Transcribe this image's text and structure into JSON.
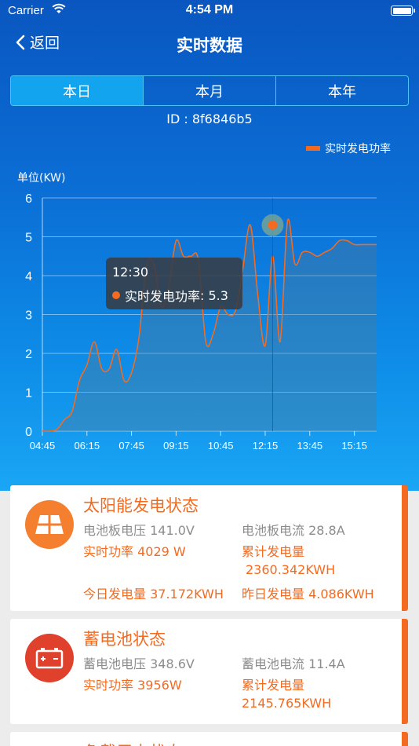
{
  "status_bar": {
    "carrier": "Carrier",
    "time": "4:54 PM"
  },
  "nav": {
    "back_label": "返回",
    "title": "实时数据"
  },
  "tabs": [
    {
      "label": "本日",
      "active": true
    },
    {
      "label": "本月",
      "active": false
    },
    {
      "label": "本年",
      "active": false
    }
  ],
  "device_id": "ID : 8f6846b5",
  "colors": {
    "accent": "#f36b21",
    "header_bg": "#0b6fd6",
    "tab_active": "#12a4ee"
  },
  "chart_data": {
    "type": "area",
    "legend": "实时发电功率",
    "legend_position": "top-right",
    "unit_label": "单位(KW)",
    "ylim": [
      0,
      6
    ],
    "yticks": [
      0,
      1,
      2,
      3,
      4,
      5,
      6
    ],
    "xlim": [
      "04:45",
      "16:00"
    ],
    "xticks": [
      "04:45",
      "06:15",
      "07:45",
      "09:15",
      "10:45",
      "12:15",
      "13:45",
      "15:15"
    ],
    "grid": true,
    "x": [
      "04:45",
      "05:00",
      "05:15",
      "05:30",
      "05:45",
      "06:00",
      "06:15",
      "06:30",
      "06:45",
      "07:00",
      "07:15",
      "07:30",
      "07:45",
      "08:00",
      "08:15",
      "08:30",
      "08:45",
      "09:00",
      "09:15",
      "09:30",
      "09:45",
      "10:00",
      "10:15",
      "10:30",
      "10:45",
      "11:00",
      "11:15",
      "11:30",
      "11:45",
      "12:00",
      "12:15",
      "12:30",
      "12:45",
      "13:00",
      "13:15",
      "13:30",
      "13:45",
      "14:00",
      "14:15",
      "14:30",
      "14:45",
      "15:00",
      "15:15",
      "15:30",
      "15:45",
      "16:00"
    ],
    "values": [
      0.0,
      0.0,
      0.05,
      0.3,
      0.5,
      1.3,
      1.7,
      2.3,
      1.6,
      1.6,
      2.1,
      1.3,
      1.5,
      2.4,
      4.2,
      4.3,
      3.2,
      3.7,
      4.9,
      4.5,
      4.5,
      4.4,
      2.3,
      2.5,
      3.2,
      3.0,
      3.1,
      4.2,
      5.3,
      3.5,
      2.2,
      4.5,
      2.3,
      5.4,
      4.3,
      4.6,
      4.6,
      4.5,
      4.6,
      4.7,
      4.9,
      4.9,
      4.8,
      4.8,
      4.8,
      4.8
    ],
    "highlight": {
      "x": "12:30",
      "label": "实时发电功率",
      "value": 5.3
    }
  },
  "cards": {
    "solar": {
      "icon": "solar-panel-icon",
      "title": "太阳能发电状态",
      "panel_voltage_label": "电池板电压",
      "panel_voltage": "141.0V",
      "panel_current_label": "电池板电流",
      "panel_current": "28.8A",
      "power_label": "实时功率",
      "power": "4029 W",
      "total_label": "累计发电量",
      "total": "2360.342KWH",
      "today_label": "今日发电量",
      "today": "37.172KWH",
      "yesterday_label": "昨日发电量",
      "yesterday": "4.086KWH"
    },
    "battery": {
      "icon": "battery-icon",
      "title": "蓄电池状态",
      "voltage_label": "蓄电池电压",
      "voltage": "348.6V",
      "current_label": "蓄电池电流",
      "current": "11.4A",
      "power_label": "实时功率",
      "power": "3956W",
      "total_label": "累计发电量",
      "total": "2145.765KWH"
    },
    "load": {
      "title": "负载用电状态"
    }
  }
}
